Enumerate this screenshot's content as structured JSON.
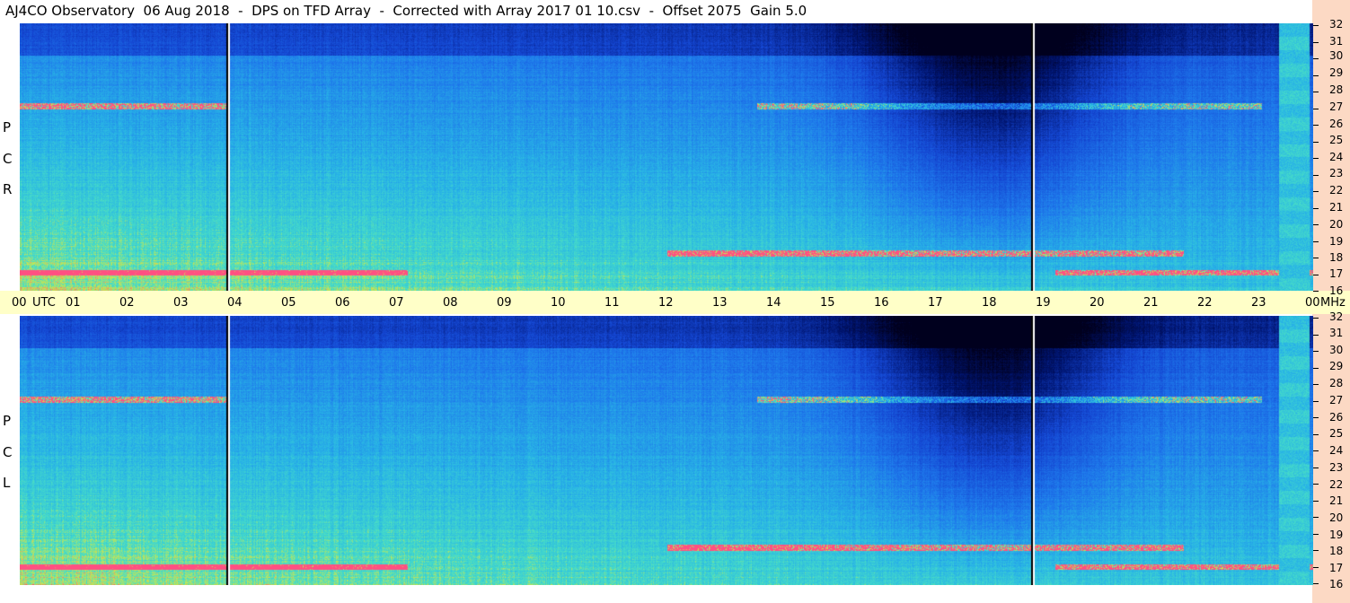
{
  "title": "AJ4CO Observatory  06 Aug 2018  -  DPS on TFD Array  -  Corrected with Array 2017 01 10.csv  -  Offset 2075  Gain 5.0",
  "chart_data": {
    "type": "heatmap",
    "title": "AJ4CO Observatory  06 Aug 2018  -  DPS on TFD Array  -  Corrected with Array 2017 01 10.csv  -  Offset 2075  Gain 5.0",
    "x_axis": {
      "ticks": [
        "00",
        "UTC",
        "01",
        "02",
        "03",
        "04",
        "05",
        "06",
        "07",
        "08",
        "09",
        "10",
        "11",
        "12",
        "13",
        "14",
        "15",
        "16",
        "17",
        "18",
        "19",
        "20",
        "21",
        "22",
        "23",
        "00",
        "MHz"
      ]
    },
    "y_axis": {
      "ticks": [
        "32",
        "31",
        "30",
        "29",
        "28",
        "27",
        "26",
        "25",
        "24",
        "23",
        "22",
        "21",
        "20",
        "19",
        "18",
        "17",
        "16"
      ]
    },
    "panels": [
      {
        "name": "RCP",
        "letters": [
          "P",
          "C",
          "R"
        ]
      },
      {
        "name": "LCP",
        "letters": [
          "P",
          "C",
          "L"
        ]
      }
    ],
    "colors": {
      "low": "#000428",
      "mid": "#1e6be0",
      "high": "#3cd0e0",
      "hot": "#f0e040",
      "peak": "#ff4080"
    }
  }
}
